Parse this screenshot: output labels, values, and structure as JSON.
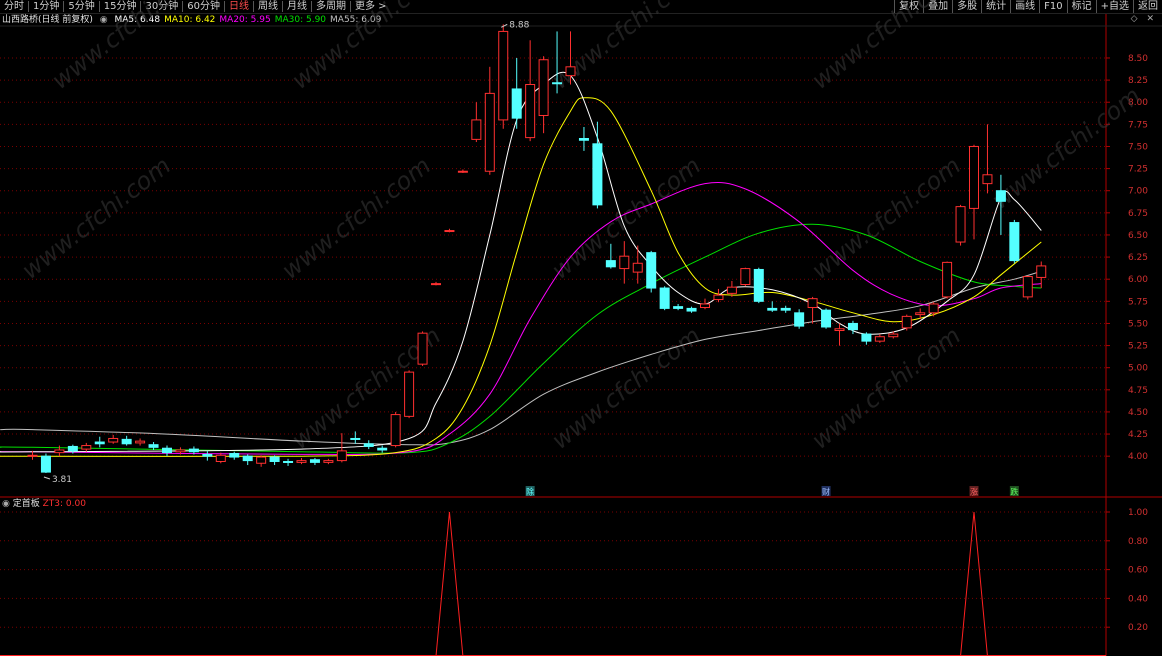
{
  "toolbar": {
    "tabs": [
      "分时",
      "1分钟",
      "5分钟",
      "15分钟",
      "30分钟",
      "60分钟",
      "日线",
      "周线",
      "月线",
      "多周期",
      "更多 >"
    ],
    "active_tab": "日线",
    "right_buttons": [
      "复权",
      "叠加",
      "多股",
      "统计",
      "画线",
      "F10",
      "标记",
      "+自选",
      "返回"
    ]
  },
  "header": {
    "title": "山西路桥(日线 前复权)",
    "ma": [
      {
        "label": "MA5: 6.48",
        "color": "#ffffff"
      },
      {
        "label": "MA10: 6.42",
        "color": "#ffff00"
      },
      {
        "label": "MA20: 5.95",
        "color": "#ff00ff"
      },
      {
        "label": "MA30: 5.90",
        "color": "#00e000"
      },
      {
        "label": "MA55: 6.09",
        "color": "#c0c0c0"
      }
    ],
    "icons": [
      "diamond-icon",
      "close-icon"
    ]
  },
  "indicator": {
    "name": "定首板",
    "value_label": "ZT3: 0.00",
    "value_color": "#ff3030"
  },
  "colors": {
    "up": "#ff3030",
    "down": "#54ffff",
    "grid": "#7a0000",
    "axis": "#b00000",
    "ma5": "#ffffff",
    "ma10": "#ffff00",
    "ma20": "#ff00ff",
    "ma30": "#00e000",
    "ma55": "#c0c0c0",
    "ind_line": "#ff2020"
  },
  "chart_data": [
    {
      "type": "candlestick",
      "y_ticks": [
        "4.00",
        "4.25",
        "4.50",
        "4.75",
        "5.00",
        "5.25",
        "5.50",
        "5.75",
        "6.00",
        "6.25",
        "6.50",
        "6.75",
        "7.00",
        "7.25",
        "7.50",
        "7.75",
        "8.00",
        "8.25",
        "8.50"
      ],
      "ylim": [
        3.55,
        8.85
      ],
      "high_annotation": "8.88",
      "low_annotation": "3.81",
      "candles": [
        {
          "o": 4.0,
          "c": 4.01,
          "h": 4.06,
          "l": 3.96
        },
        {
          "o": 4.0,
          "c": 3.82,
          "h": 4.03,
          "l": 3.81
        },
        {
          "o": 4.04,
          "c": 4.07,
          "h": 4.12,
          "l": 4.0
        },
        {
          "o": 4.11,
          "c": 4.06,
          "h": 4.13,
          "l": 4.03
        },
        {
          "o": 4.08,
          "c": 4.12,
          "h": 4.15,
          "l": 4.05
        },
        {
          "o": 4.16,
          "c": 4.14,
          "h": 4.22,
          "l": 4.1
        },
        {
          "o": 4.16,
          "c": 4.2,
          "h": 4.24,
          "l": 4.14
        },
        {
          "o": 4.19,
          "c": 4.14,
          "h": 4.23,
          "l": 4.12
        },
        {
          "o": 4.15,
          "c": 4.17,
          "h": 4.2,
          "l": 4.12
        },
        {
          "o": 4.13,
          "c": 4.1,
          "h": 4.16,
          "l": 4.07
        },
        {
          "o": 4.09,
          "c": 4.04,
          "h": 4.12,
          "l": 4.0
        },
        {
          "o": 4.05,
          "c": 4.07,
          "h": 4.1,
          "l": 4.02
        },
        {
          "o": 4.08,
          "c": 4.05,
          "h": 4.11,
          "l": 4.02
        },
        {
          "o": 4.02,
          "c": 4.0,
          "h": 4.06,
          "l": 3.95
        },
        {
          "o": 3.94,
          "c": 4.01,
          "h": 4.04,
          "l": 3.92
        },
        {
          "o": 4.03,
          "c": 3.99,
          "h": 4.05,
          "l": 3.96
        },
        {
          "o": 4.0,
          "c": 3.95,
          "h": 4.02,
          "l": 3.9
        },
        {
          "o": 3.92,
          "c": 3.99,
          "h": 4.01,
          "l": 3.88
        },
        {
          "o": 3.99,
          "c": 3.94,
          "h": 4.01,
          "l": 3.9
        },
        {
          "o": 3.94,
          "c": 3.93,
          "h": 3.97,
          "l": 3.89
        },
        {
          "o": 3.93,
          "c": 3.95,
          "h": 3.98,
          "l": 3.91
        },
        {
          "o": 3.96,
          "c": 3.93,
          "h": 3.98,
          "l": 3.9
        },
        {
          "o": 3.93,
          "c": 3.95,
          "h": 3.97,
          "l": 3.91
        },
        {
          "o": 3.95,
          "c": 4.06,
          "h": 4.26,
          "l": 3.93
        },
        {
          "o": 4.2,
          "c": 4.19,
          "h": 4.28,
          "l": 4.14
        },
        {
          "o": 4.14,
          "c": 4.11,
          "h": 4.18,
          "l": 4.08
        },
        {
          "o": 4.09,
          "c": 4.07,
          "h": 4.12,
          "l": 4.04
        },
        {
          "o": 4.12,
          "c": 4.47,
          "h": 4.5,
          "l": 4.1
        },
        {
          "o": 4.45,
          "c": 4.95,
          "h": 4.97,
          "l": 4.43
        },
        {
          "o": 5.04,
          "c": 5.39,
          "h": 5.41,
          "l": 5.02
        },
        {
          "o": 5.94,
          "c": 5.95,
          "h": 5.97,
          "l": 5.93
        },
        {
          "o": 6.54,
          "c": 6.55,
          "h": 6.57,
          "l": 6.53
        },
        {
          "o": 7.21,
          "c": 7.22,
          "h": 7.24,
          "l": 7.2
        },
        {
          "o": 7.58,
          "c": 7.8,
          "h": 8.0,
          "l": 7.55
        },
        {
          "o": 7.22,
          "c": 8.1,
          "h": 8.4,
          "l": 7.18
        },
        {
          "o": 7.8,
          "c": 8.8,
          "h": 8.88,
          "l": 7.7
        },
        {
          "o": 8.15,
          "c": 7.82,
          "h": 8.5,
          "l": 7.7
        },
        {
          "o": 7.6,
          "c": 8.2,
          "h": 8.7,
          "l": 7.56
        },
        {
          "o": 7.85,
          "c": 8.48,
          "h": 8.52,
          "l": 7.65
        },
        {
          "o": 8.22,
          "c": 8.21,
          "h": 8.8,
          "l": 8.1
        },
        {
          "o": 8.3,
          "c": 8.4,
          "h": 8.8,
          "l": 8.2
        },
        {
          "o": 7.59,
          "c": 7.57,
          "h": 7.72,
          "l": 7.45
        },
        {
          "o": 7.53,
          "c": 6.84,
          "h": 7.78,
          "l": 6.8
        },
        {
          "o": 6.21,
          "c": 6.14,
          "h": 6.4,
          "l": 6.12
        },
        {
          "o": 6.12,
          "c": 6.26,
          "h": 6.43,
          "l": 5.95
        },
        {
          "o": 6.08,
          "c": 6.18,
          "h": 6.38,
          "l": 5.95
        },
        {
          "o": 6.3,
          "c": 5.9,
          "h": 6.32,
          "l": 5.85
        },
        {
          "o": 5.9,
          "c": 5.67,
          "h": 5.92,
          "l": 5.65
        },
        {
          "o": 5.69,
          "c": 5.67,
          "h": 5.72,
          "l": 5.65
        },
        {
          "o": 5.67,
          "c": 5.64,
          "h": 5.69,
          "l": 5.62
        },
        {
          "o": 5.68,
          "c": 5.72,
          "h": 5.78,
          "l": 5.66
        },
        {
          "o": 5.77,
          "c": 5.82,
          "h": 5.89,
          "l": 5.74
        },
        {
          "o": 5.84,
          "c": 5.91,
          "h": 5.98,
          "l": 5.8
        },
        {
          "o": 5.94,
          "c": 6.12,
          "h": 6.13,
          "l": 5.92
        },
        {
          "o": 6.11,
          "c": 5.75,
          "h": 6.13,
          "l": 5.73
        },
        {
          "o": 5.67,
          "c": 5.65,
          "h": 5.75,
          "l": 5.63
        },
        {
          "o": 5.67,
          "c": 5.65,
          "h": 5.7,
          "l": 5.62
        },
        {
          "o": 5.62,
          "c": 5.47,
          "h": 5.66,
          "l": 5.44
        },
        {
          "o": 5.68,
          "c": 5.78,
          "h": 5.8,
          "l": 5.5
        },
        {
          "o": 5.65,
          "c": 5.46,
          "h": 5.67,
          "l": 5.44
        },
        {
          "o": 5.42,
          "c": 5.44,
          "h": 5.5,
          "l": 5.25
        },
        {
          "o": 5.5,
          "c": 5.43,
          "h": 5.53,
          "l": 5.38
        },
        {
          "o": 5.38,
          "c": 5.3,
          "h": 5.4,
          "l": 5.26
        },
        {
          "o": 5.3,
          "c": 5.35,
          "h": 5.38,
          "l": 5.28
        },
        {
          "o": 5.35,
          "c": 5.38,
          "h": 5.41,
          "l": 5.33
        },
        {
          "o": 5.45,
          "c": 5.58,
          "h": 5.6,
          "l": 5.42
        },
        {
          "o": 5.6,
          "c": 5.62,
          "h": 5.67,
          "l": 5.55
        },
        {
          "o": 5.62,
          "c": 5.72,
          "h": 5.74,
          "l": 5.58
        },
        {
          "o": 5.8,
          "c": 6.19,
          "h": 6.2,
          "l": 5.78
        },
        {
          "o": 6.42,
          "c": 6.82,
          "h": 6.84,
          "l": 6.38
        },
        {
          "o": 6.8,
          "c": 7.5,
          "h": 7.52,
          "l": 6.45
        },
        {
          "o": 7.08,
          "c": 7.18,
          "h": 7.75,
          "l": 6.97
        },
        {
          "o": 7.0,
          "c": 6.88,
          "h": 7.18,
          "l": 6.5
        },
        {
          "o": 6.64,
          "c": 6.21,
          "h": 6.67,
          "l": 6.18
        },
        {
          "o": 5.8,
          "c": 6.03,
          "h": 6.04,
          "l": 5.77
        },
        {
          "o": 6.02,
          "c": 6.15,
          "h": 6.2,
          "l": 5.9
        }
      ],
      "ma_curves": {
        "ma5": [
          [
            0,
            4.05
          ],
          [
            20,
            4.08
          ],
          [
            28,
            4.2
          ],
          [
            30,
            4.6
          ],
          [
            32,
            5.3
          ],
          [
            34,
            6.5
          ],
          [
            36,
            7.8
          ],
          [
            38,
            8.2
          ],
          [
            40,
            8.3
          ],
          [
            42,
            7.6
          ],
          [
            44,
            6.6
          ],
          [
            46,
            6.15
          ],
          [
            48,
            5.85
          ],
          [
            50,
            5.72
          ],
          [
            52,
            5.9
          ],
          [
            55,
            5.88
          ],
          [
            58,
            5.72
          ],
          [
            60,
            5.5
          ],
          [
            62,
            5.38
          ],
          [
            65,
            5.45
          ],
          [
            68,
            5.75
          ],
          [
            70,
            6.05
          ],
          [
            72,
            6.92
          ],
          [
            73,
            6.9
          ],
          [
            75,
            6.55
          ]
        ],
        "ma10": [
          [
            0,
            4.0
          ],
          [
            20,
            4.0
          ],
          [
            27,
            4.04
          ],
          [
            30,
            4.2
          ],
          [
            32,
            4.55
          ],
          [
            34,
            5.25
          ],
          [
            36,
            6.3
          ],
          [
            38,
            7.3
          ],
          [
            40,
            7.9
          ],
          [
            41,
            8.05
          ],
          [
            43,
            7.9
          ],
          [
            46,
            7.0
          ],
          [
            48,
            6.3
          ],
          [
            50,
            5.9
          ],
          [
            52,
            5.82
          ],
          [
            55,
            5.85
          ],
          [
            58,
            5.75
          ],
          [
            61,
            5.62
          ],
          [
            64,
            5.52
          ],
          [
            67,
            5.6
          ],
          [
            70,
            5.8
          ],
          [
            72,
            6.05
          ],
          [
            75,
            6.42
          ]
        ],
        "ma20": [
          [
            0,
            4.05
          ],
          [
            20,
            4.02
          ],
          [
            28,
            4.05
          ],
          [
            31,
            4.25
          ],
          [
            34,
            4.7
          ],
          [
            37,
            5.55
          ],
          [
            40,
            6.25
          ],
          [
            43,
            6.65
          ],
          [
            46,
            6.85
          ],
          [
            50,
            7.08
          ],
          [
            53,
            7.02
          ],
          [
            57,
            6.65
          ],
          [
            61,
            6.1
          ],
          [
            64,
            5.82
          ],
          [
            67,
            5.7
          ],
          [
            70,
            5.78
          ],
          [
            72,
            5.9
          ],
          [
            75,
            5.95
          ]
        ],
        "ma30": [
          [
            0,
            4.1
          ],
          [
            20,
            4.05
          ],
          [
            28,
            4.04
          ],
          [
            31,
            4.15
          ],
          [
            34,
            4.45
          ],
          [
            38,
            5.05
          ],
          [
            42,
            5.6
          ],
          [
            46,
            5.95
          ],
          [
            50,
            6.25
          ],
          [
            54,
            6.52
          ],
          [
            58,
            6.62
          ],
          [
            62,
            6.5
          ],
          [
            66,
            6.2
          ],
          [
            70,
            5.97
          ],
          [
            73,
            5.92
          ],
          [
            75,
            5.9
          ]
        ],
        "ma55": [
          [
            0,
            4.3
          ],
          [
            10,
            4.25
          ],
          [
            20,
            4.17
          ],
          [
            28,
            4.13
          ],
          [
            31,
            4.15
          ],
          [
            34,
            4.3
          ],
          [
            38,
            4.7
          ],
          [
            42,
            4.95
          ],
          [
            46,
            5.15
          ],
          [
            50,
            5.32
          ],
          [
            54,
            5.42
          ],
          [
            58,
            5.52
          ],
          [
            62,
            5.6
          ],
          [
            66,
            5.7
          ],
          [
            70,
            5.9
          ],
          [
            73,
            6.0
          ],
          [
            75,
            6.09
          ]
        ]
      },
      "markers": [
        {
          "index": 37,
          "text": "除"
        },
        {
          "index": 59,
          "text": "财"
        },
        {
          "index": 70,
          "text": "涨"
        },
        {
          "index": 73,
          "text": "跌"
        }
      ]
    },
    {
      "type": "line",
      "name": "ZT3",
      "y_ticks": [
        "0.20",
        "0.40",
        "0.60",
        "0.80",
        "1.00"
      ],
      "ylim": [
        0,
        1.0
      ],
      "spikes_at_index": [
        31,
        70
      ]
    }
  ]
}
